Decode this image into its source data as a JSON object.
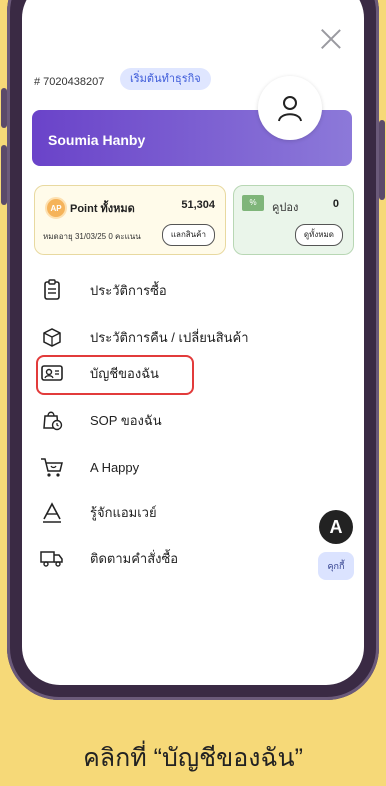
{
  "screen": {
    "member_id": "# 7020438207",
    "badge": "เริ่มต้นทำธุรกิจ",
    "profile_name": "Soumia Hanby",
    "points": {
      "icon_text": "AP",
      "label": "Point ทั้งหมด",
      "value": "51,304",
      "expiry": "หมดอายุ 31/03/25 0 คะแนน",
      "button": "แลกสินค้า"
    },
    "coupon": {
      "label": "คูปอง",
      "value": "0",
      "button": "ดูทั้งหมด"
    },
    "menu": [
      {
        "label": "ประวัติการซื้อ",
        "icon": "receipt-icon"
      },
      {
        "label": "ประวัติการคืน / เปลี่ยนสินค้า",
        "icon": "return-box-icon"
      },
      {
        "label": "บัญชีของฉัน",
        "icon": "id-card-icon"
      },
      {
        "label": "SOP ของฉัน",
        "icon": "bag-clock-icon"
      },
      {
        "label": "A Happy",
        "icon": "cart-smile-icon"
      },
      {
        "label": "รู้จักแอมเวย์",
        "icon": "amway-logo-icon"
      },
      {
        "label": "ติดตามคำสั่งซื้อ",
        "icon": "truck-icon"
      }
    ],
    "fab_letter": "A",
    "chat_tag": "คุกกี้"
  },
  "caption": "คลิกที่ “บัญชีของฉัน”",
  "colors": {
    "background": "#f6d978",
    "profile_gradient_start": "#6a43c9",
    "highlight": "#e23b3b"
  }
}
